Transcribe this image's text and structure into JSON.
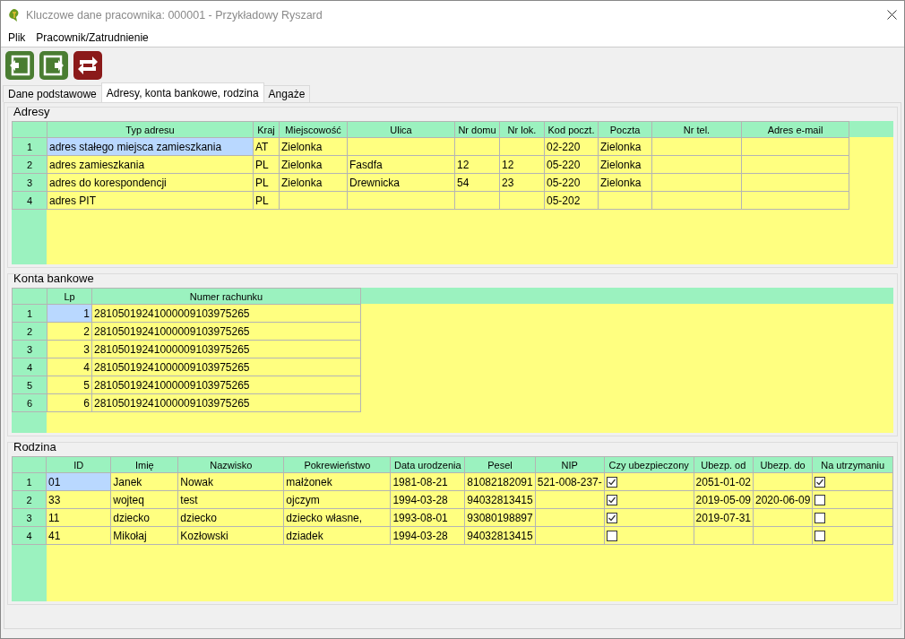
{
  "window": {
    "title": "Kluczowe dane pracownika: 000001 - Przykładowy Ryszard"
  },
  "menu": [
    "Plik",
    "Pracownik/Zatrudnienie"
  ],
  "tabs": [
    {
      "label": "Dane podstawowe",
      "selected": false
    },
    {
      "label": "Adresy, konta bankowe, rodzina",
      "selected": true
    },
    {
      "label": "Angaże",
      "selected": false
    }
  ],
  "sections": [
    {
      "kind": "addresses",
      "title": "Adresy",
      "columns": [
        "Typ adresu",
        "Kraj",
        "Miejscowość",
        "Ulica",
        "Nr domu",
        "Nr lok.",
        "Kod poczt.",
        "Poczta",
        "Nr tel.",
        "Adres e-mail"
      ],
      "rows": [
        {
          "number": "1",
          "selected": true,
          "cells": [
            "adres stałego miejsca zamieszkania",
            "AT",
            "Zielonka",
            null,
            null,
            null,
            "02-220",
            "Zielonka",
            null,
            null
          ]
        },
        {
          "number": "2",
          "selected": false,
          "cells": [
            "adres zamieszkania",
            "PL",
            "Zielonka",
            "Fasdfa",
            "12",
            "12",
            "05-220",
            "Zielonka",
            null,
            null
          ]
        },
        {
          "number": "3",
          "selected": false,
          "cells": [
            "adres do korespondencji",
            "PL",
            "Zielonka",
            "Drewnicka",
            "54",
            "23",
            "05-220",
            "Zielonka",
            null,
            null
          ]
        },
        {
          "number": "4",
          "selected": false,
          "cells": [
            "adres PIT",
            "PL",
            null,
            null,
            null,
            null,
            "05-202",
            null,
            null,
            null
          ]
        }
      ]
    },
    {
      "kind": "accounts",
      "title": "Konta bankowe",
      "columns": [
        "Lp",
        "Numer rachunku"
      ],
      "rows": [
        {
          "number": "1",
          "selected": true,
          "cells": [
            "1",
            "28105019241000009103975265"
          ]
        },
        {
          "number": "2",
          "selected": false,
          "cells": [
            "2",
            "28105019241000009103975265"
          ]
        },
        {
          "number": "3",
          "selected": false,
          "cells": [
            "3",
            "28105019241000009103975265"
          ]
        },
        {
          "number": "4",
          "selected": false,
          "cells": [
            "4",
            "28105019241000009103975265"
          ]
        },
        {
          "number": "5",
          "selected": false,
          "cells": [
            "5",
            "28105019241000009103975265"
          ]
        },
        {
          "number": "6",
          "selected": false,
          "cells": [
            "6",
            "28105019241000009103975265"
          ]
        }
      ]
    },
    {
      "kind": "family",
      "title": "Rodzina",
      "columns": [
        "ID",
        "Imię",
        "Nazwisko",
        "Pokrewieństwo",
        "Data urodzenia",
        "Pesel",
        "NIP",
        "Czy ubezpieczony",
        "Ubezp. od",
        "Ubezp. do",
        "Na utrzymaniu"
      ],
      "rows": [
        {
          "number": "1",
          "selected": true,
          "cells": [
            "01",
            "Janek",
            "Nowak",
            "małżonek",
            "1981-08-21",
            "81082182091",
            "521-008-237-",
            {
              "checked": true
            },
            "2051-01-02",
            null,
            {
              "checked": true
            }
          ]
        },
        {
          "number": "2",
          "selected": false,
          "cells": [
            "33",
            "wojteq",
            "test",
            "ojczym",
            "1994-03-28",
            "94032813415",
            null,
            {
              "checked": true
            },
            "2019-05-09",
            "2020-06-09",
            {
              "checked": false
            }
          ]
        },
        {
          "number": "3",
          "selected": false,
          "cells": [
            "11",
            "dziecko",
            "dziecko",
            "dziecko własne,",
            "1993-08-01",
            "93080198897",
            null,
            {
              "checked": true
            },
            "2019-07-31",
            null,
            {
              "checked": false
            }
          ]
        },
        {
          "number": "4",
          "selected": false,
          "cells": [
            "41",
            "Mikołaj",
            "Kozłowski",
            "dziadek",
            "1994-03-28",
            "94032813415",
            null,
            {
              "checked": false
            },
            null,
            null,
            {
              "checked": false
            }
          ]
        }
      ]
    }
  ]
}
